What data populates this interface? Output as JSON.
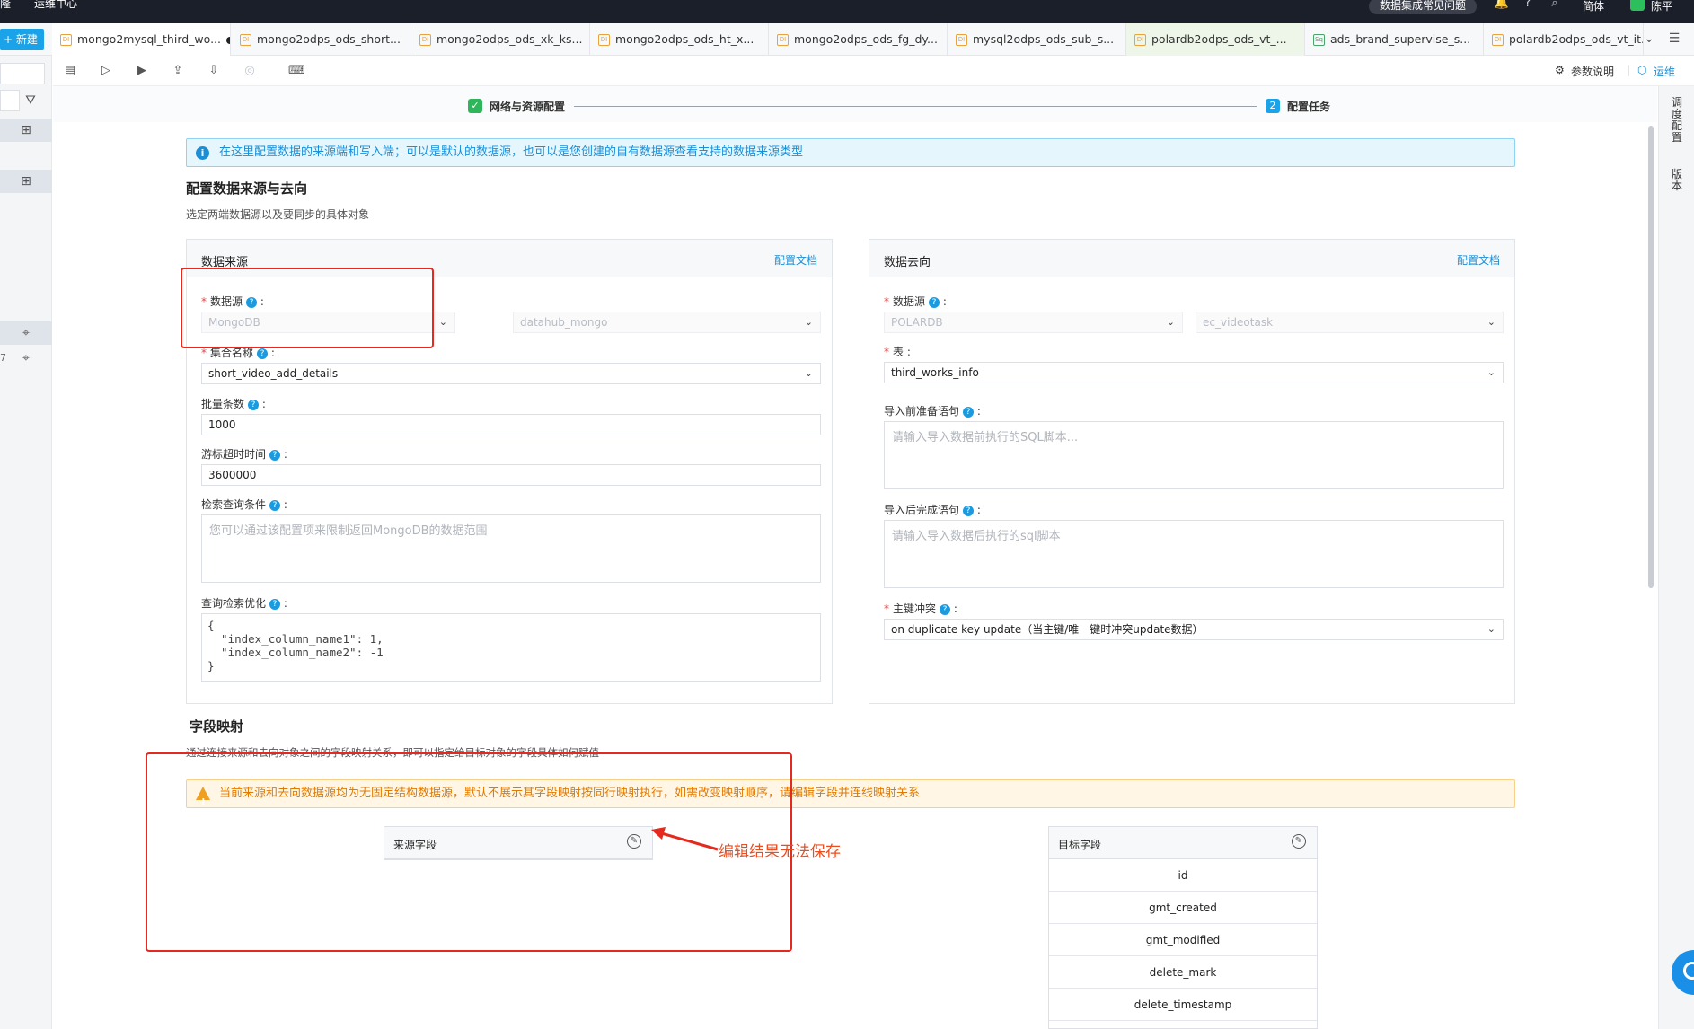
{
  "topbar": {
    "nav": [
      "隆",
      "运维中心"
    ],
    "faq": "数据集成常见问题",
    "lang": "简体",
    "user": "陈平"
  },
  "tabs": {
    "new_label": "+ 新建",
    "items": [
      {
        "label": "mongo2mysql_third_wo...",
        "icon": "DI"
      },
      {
        "label": "mongo2odps_ods_short...",
        "icon": "DI"
      },
      {
        "label": "mongo2odps_ods_xk_ks...",
        "icon": "DI"
      },
      {
        "label": "mongo2odps_ods_ht_x...",
        "icon": "DI"
      },
      {
        "label": "mongo2odps_ods_fg_dy...",
        "icon": "DI"
      },
      {
        "label": "mysql2odps_ods_sub_s...",
        "icon": "DI"
      },
      {
        "label": "polardb2odps_ods_vt_...",
        "icon": "DI"
      },
      {
        "label": "ads_brand_supervise_s...",
        "icon": "Sq"
      },
      {
        "label": "polardb2odps_ods_vt_it...",
        "icon": "DI"
      }
    ]
  },
  "toolbar": {
    "params_label": "参数说明",
    "ops_label": "运维"
  },
  "right_rail": {
    "schedule": "调度配置",
    "version": "版本"
  },
  "left_rail": {
    "partial_text": "7"
  },
  "stepper": {
    "step1": "网络与资源配置",
    "step2_num": "2",
    "step2": "配置任务"
  },
  "info_banner": "在这里配置数据的来源端和写入端；可以是默认的数据源，也可以是您创建的自有数据源查看支持的数据来源类型",
  "config": {
    "title": "配置数据来源与去向",
    "subtitle": "选定两端数据源以及要同步的具体对象"
  },
  "source": {
    "title": "数据来源",
    "doc": "配置文档",
    "datasource_label": "数据源",
    "datasource_type": "MongoDB",
    "datasource_name": "datahub_mongo",
    "collection_label": "集合名称",
    "collection_value": "short_video_add_details",
    "batch_label": "批量条数",
    "batch_value": "1000",
    "cursor_label": "游标超时时间",
    "cursor_value": "3600000",
    "query_label": "检索查询条件",
    "query_placeholder": "您可以通过该配置项来限制返回MongoDB的数据范围",
    "hint_label": "查询检索优化",
    "hint_value": "{\n  \"index_column_name1\": 1,\n  \"index_column_name2\": -1\n}"
  },
  "target": {
    "title": "数据去向",
    "doc": "配置文档",
    "datasource_label": "数据源",
    "datasource_type": "POLARDB",
    "datasource_name": "ec_videotask",
    "table_label": "表",
    "table_value": "third_works_info",
    "pre_sql_label": "导入前准备语句",
    "pre_sql_placeholder": "请输入导入数据前执行的SQL脚本...",
    "post_sql_label": "导入后完成语句",
    "post_sql_placeholder": "请输入导入数据后执行的sql脚本",
    "conflict_label": "主键冲突",
    "conflict_value": "on duplicate key update（当主键/唯一键时冲突update数据）"
  },
  "mapping": {
    "title": "字段映射",
    "subtitle": "通过连接来源和去向对象之间的字段映射关系，即可以指定给目标对象的字段具体如何赋值",
    "warning": "当前来源和去向数据源均为无固定结构数据源，默认不展示其字段映射按同行映射执行，如需改变映射顺序，请编辑字段并连线映射关系",
    "source_header": "来源字段",
    "target_header": "目标字段",
    "target_fields": [
      "id",
      "gmt_created",
      "gmt_modified",
      "delete_mark",
      "delete_timestamp"
    ]
  },
  "annotation": "编辑结果无法保存",
  "colors": {
    "accent": "#1aa3e8",
    "annotation_red": "#e5291e",
    "warning": "#e07a00"
  }
}
